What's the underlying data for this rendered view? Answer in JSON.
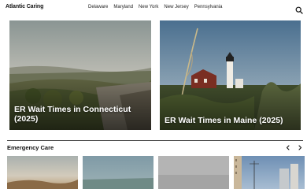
{
  "header": {
    "logo": "Atlantic Caring",
    "nav": [
      "Delaware",
      "Maryland",
      "New York",
      "New Jersey",
      "Pennsylvania"
    ],
    "search_icon": "search-icon"
  },
  "featured": [
    {
      "title": "ER Wait Times in Connecticut (2025)"
    },
    {
      "title": "ER Wait Times in Maine (2025)"
    }
  ],
  "section": {
    "title": "Emergency Care",
    "prev_icon": "chevron-left-icon",
    "next_icon": "chevron-right-icon"
  },
  "colors": {
    "text": "#111111",
    "background": "#ffffff",
    "divider": "#444444"
  }
}
